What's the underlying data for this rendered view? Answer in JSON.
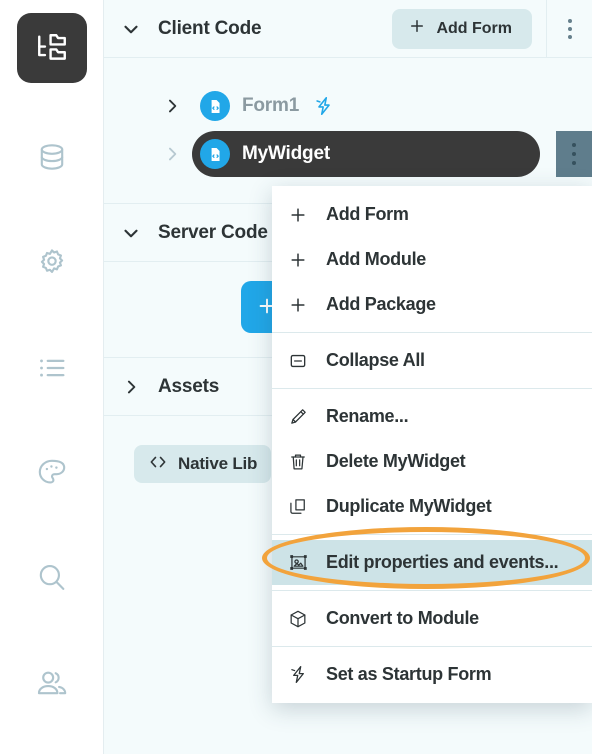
{
  "rail": {
    "items": [
      {
        "name": "app-tree-icon",
        "label": "App Browser",
        "active": true
      },
      {
        "name": "database-icon",
        "label": "Data Tables",
        "active": false
      },
      {
        "name": "gear-icon",
        "label": "Settings",
        "active": false
      },
      {
        "name": "list-icon",
        "label": "Dependencies",
        "active": false
      },
      {
        "name": "palette-icon",
        "label": "Theme",
        "active": false
      },
      {
        "name": "search-icon",
        "label": "Search",
        "active": false
      },
      {
        "name": "users-icon",
        "label": "Users",
        "active": false
      }
    ]
  },
  "tree": {
    "sections": [
      {
        "title": "Client Code",
        "expanded": true,
        "action_label": "Add Form"
      },
      {
        "title": "Server Code",
        "expanded": true
      },
      {
        "title": "Assets",
        "expanded": false
      }
    ],
    "client_code": {
      "title": "Client Code",
      "add_form_label": "Add Form",
      "nodes": [
        {
          "label": "Form1",
          "selected": false,
          "startup": true
        },
        {
          "label": "MyWidget",
          "selected": true,
          "startup": false
        }
      ]
    },
    "server_code": {
      "title": "Server Code",
      "add_label": "+"
    },
    "assets": {
      "title": "Assets",
      "chip_label": "Native Lib"
    }
  },
  "context_menu": {
    "items": [
      {
        "label": "Add Form",
        "icon": "plus-icon",
        "highlighted": false,
        "sep_after": false
      },
      {
        "label": "Add Module",
        "icon": "plus-icon",
        "highlighted": false,
        "sep_after": false
      },
      {
        "label": "Add Package",
        "icon": "plus-icon",
        "highlighted": false,
        "sep_after": true
      },
      {
        "label": "Collapse All",
        "icon": "collapse-icon",
        "highlighted": false,
        "sep_after": true
      },
      {
        "label": "Rename...",
        "icon": "pencil-icon",
        "highlighted": false,
        "sep_after": false
      },
      {
        "label": "Delete MyWidget",
        "icon": "trash-icon",
        "highlighted": false,
        "sep_after": false
      },
      {
        "label": "Duplicate MyWidget",
        "icon": "duplicate-icon",
        "highlighted": false,
        "sep_after": true
      },
      {
        "label": "Edit properties and events...",
        "icon": "edit-properties-icon",
        "highlighted": true,
        "sep_after": true
      },
      {
        "label": "Convert to Module",
        "icon": "cube-icon",
        "highlighted": false,
        "sep_after": true
      },
      {
        "label": "Set as Startup Form",
        "icon": "bolt-icon",
        "highlighted": false,
        "sep_after": false
      }
    ]
  },
  "colors": {
    "accent_blue": "#21a7e8",
    "panel_bg": "#f4fbfc",
    "selected_dark": "#3a3a3a",
    "chip_bg": "#d7e9ec",
    "menu_highlight": "#cde3e7",
    "annotation_orange": "#f2a33c",
    "kebab_slate": "#5f7d8c"
  }
}
